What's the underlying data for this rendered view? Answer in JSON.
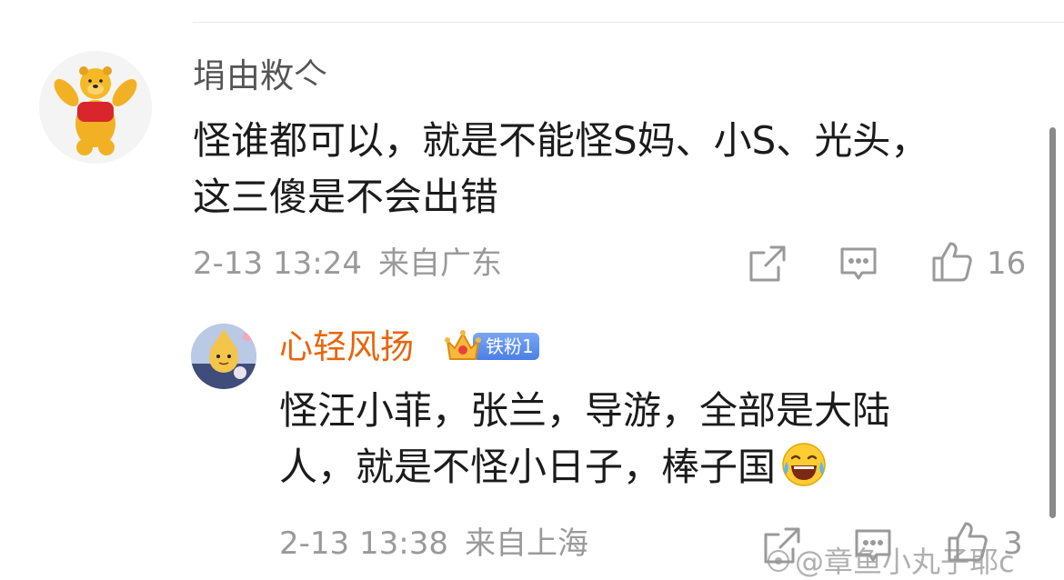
{
  "comments": [
    {
      "username": "埍由敉亽",
      "text_lines": [
        "怪谁都可以，就是不能怪S妈、小S、光头，",
        "这三傻是不会出错"
      ],
      "time": "2-13 13:24",
      "location": "来自广东",
      "like_count": "16",
      "avatar_icon": "winnie-the-pooh-avatar"
    },
    {
      "username": "心轻风扬",
      "badge": "铁粉1",
      "text_lines": [
        "怪汪小菲，张兰，导游，全部是大陆",
        "人，就是不怪小日子，棒子国"
      ],
      "emoji": "laughing-crying-emoji",
      "time": "2-13 13:38",
      "location": "来自上海",
      "like_count": "3",
      "avatar_icon": "cartoon-character-avatar"
    }
  ],
  "watermark": "@章鱼小丸子耶c",
  "colors": {
    "username_secondary": "#555555",
    "username_fan": "#e8650c",
    "meta_gray": "#9a9a9a",
    "badge_blue": "#4a7fe8"
  }
}
